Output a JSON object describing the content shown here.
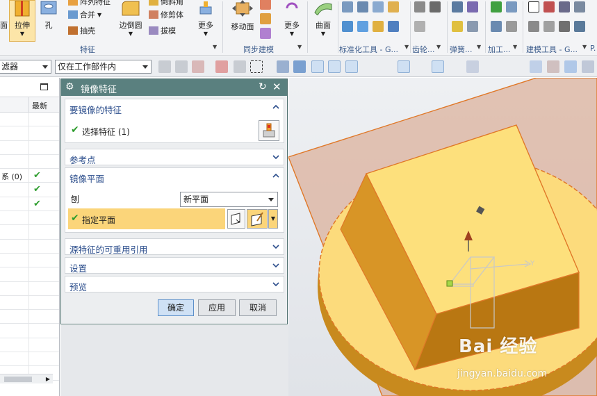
{
  "ribbon": {
    "buttons": {
      "face": "面",
      "extrude": "拉伸",
      "hole": "孔",
      "pattern_feature": "阵列特征",
      "unite": "合并",
      "shell": "抽壳",
      "edge_blend": "边倒圆",
      "chamfer": "倒斜角",
      "trim_body": "修剪体",
      "draft": "拔模",
      "more1": "更多",
      "move_face": "移动面",
      "more2": "更多",
      "surface": "曲面"
    },
    "group_labels": {
      "feature": "特征",
      "sync_modeling": "同步建模",
      "std_tools": "标准化工具 - G...",
      "gear": "齿轮...",
      "spring": "弹簧...",
      "machining": "加工...",
      "modeling_tools": "建模工具 - G...",
      "extra": "P."
    }
  },
  "toolbar": {
    "filter_label": "滤器",
    "scope_value": "仅在工作部件内"
  },
  "navigator": {
    "column_latest": "最新",
    "rows": [
      {
        "text": "",
        "check": ""
      },
      {
        "text": "",
        "check": ""
      },
      {
        "text": "",
        "check": ""
      },
      {
        "text": "",
        "check": ""
      },
      {
        "text": "系 (0)",
        "check": "✔"
      },
      {
        "text": "",
        "check": "✔"
      },
      {
        "text": "",
        "check": "✔"
      },
      {
        "text": "",
        "check": ""
      },
      {
        "text": "",
        "check": ""
      },
      {
        "text": "",
        "check": ""
      },
      {
        "text": "",
        "check": ""
      },
      {
        "text": "",
        "check": ""
      },
      {
        "text": "",
        "check": ""
      },
      {
        "text": "",
        "check": ""
      },
      {
        "text": "",
        "check": ""
      },
      {
        "text": "",
        "check": ""
      },
      {
        "text": "",
        "check": ""
      },
      {
        "text": "",
        "check": ""
      },
      {
        "text": "",
        "check": ""
      }
    ]
  },
  "dialog": {
    "title": "镜像特征",
    "sections": {
      "features_to_mirror": "要镜像的特征",
      "select_feature": "选择特征 (1)",
      "reference_point": "参考点",
      "mirror_plane": "镜像平面",
      "plane_label": "刨",
      "plane_value": "新平面",
      "specify_plane": "指定平面",
      "reusable_refs": "源特征的可重用引用",
      "settings": "设置",
      "preview": "预览"
    },
    "buttons": {
      "ok": "确定",
      "apply": "应用",
      "cancel": "取消"
    }
  },
  "viewport": {
    "axis_label": "Y",
    "watermark": "Bai 经验",
    "watermark_url": "jingyan.baidu.com"
  },
  "colors": {
    "dialog_title": "#5a807f",
    "highlight": "#fbd57a",
    "model": "#f5c542",
    "accent_link": "#2c4e8c"
  }
}
